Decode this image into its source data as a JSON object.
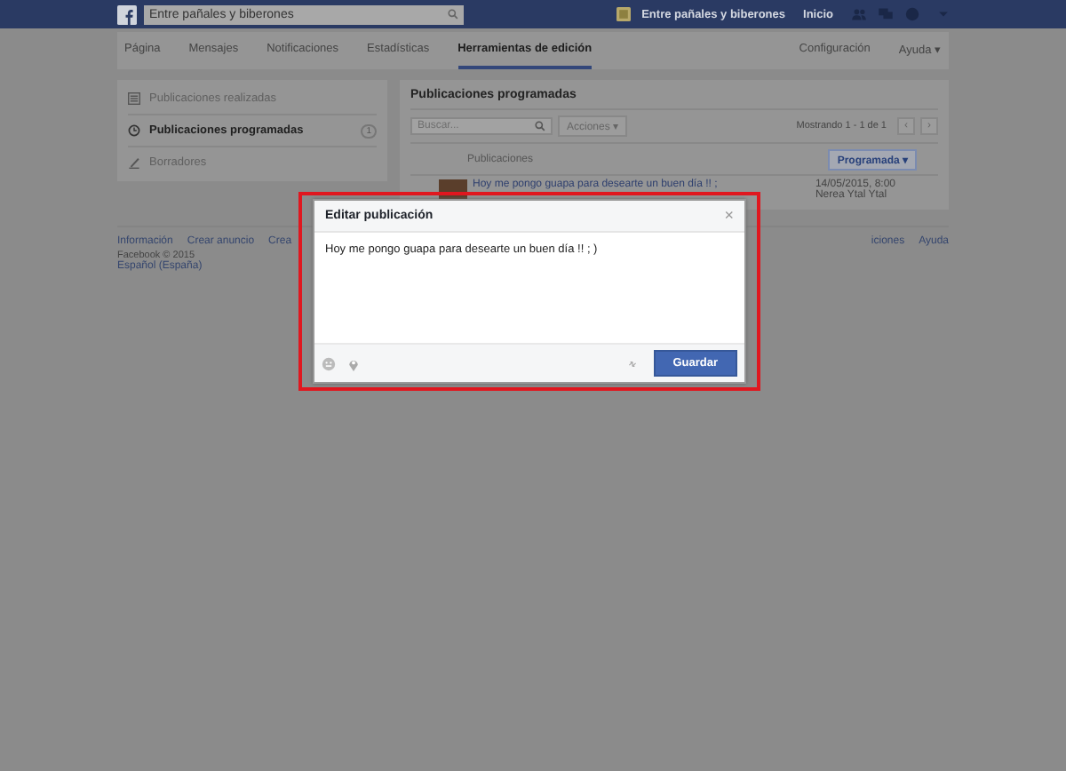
{
  "topbar": {
    "search_value": "Entre pañales y biberones",
    "page_name": "Entre pañales y biberones",
    "home": "Inicio"
  },
  "nav": {
    "tabs": [
      {
        "label": "Página",
        "selected": false
      },
      {
        "label": "Mensajes",
        "selected": false
      },
      {
        "label": "Notificaciones",
        "selected": false
      },
      {
        "label": "Estadísticas",
        "selected": false
      },
      {
        "label": "Herramientas de edición",
        "selected": true
      }
    ],
    "right": [
      "Configuración",
      "Ayuda ▾"
    ]
  },
  "sidebar": {
    "items": [
      {
        "label": "Publicaciones realizadas",
        "selected": false,
        "kind": "list"
      },
      {
        "label": "Publicaciones programadas",
        "selected": true,
        "kind": "clock",
        "badge": "1"
      },
      {
        "label": "Borradores",
        "selected": false,
        "kind": "pen"
      }
    ]
  },
  "panel": {
    "title": "Publicaciones programadas",
    "search": {
      "placeholder": "Buscar..."
    },
    "actions": "Acciones ▾",
    "paging": "Mostrando 1 - 1 de 1",
    "prev": "‹",
    "next": "›",
    "column": "Publicaciones",
    "filter": "Programada ▾",
    "rows": [
      {
        "text": "Hoy me pongo guapa para desearte un buen día !! ;",
        "date": "14/05/2015, 8:00",
        "author": "Nerea Ytal Ytal"
      }
    ]
  },
  "footer": {
    "links": [
      "Información",
      "Crear anuncio",
      "Crea",
      "iciones",
      "Ayuda"
    ],
    "copyright": "Facebook © 2015",
    "language": "Español (España)"
  },
  "dialog": {
    "title": "Editar publicación",
    "close": "×",
    "value": "Hoy me pongo guapa para desearte un buen día !! ; )",
    "save": "Guardar"
  }
}
